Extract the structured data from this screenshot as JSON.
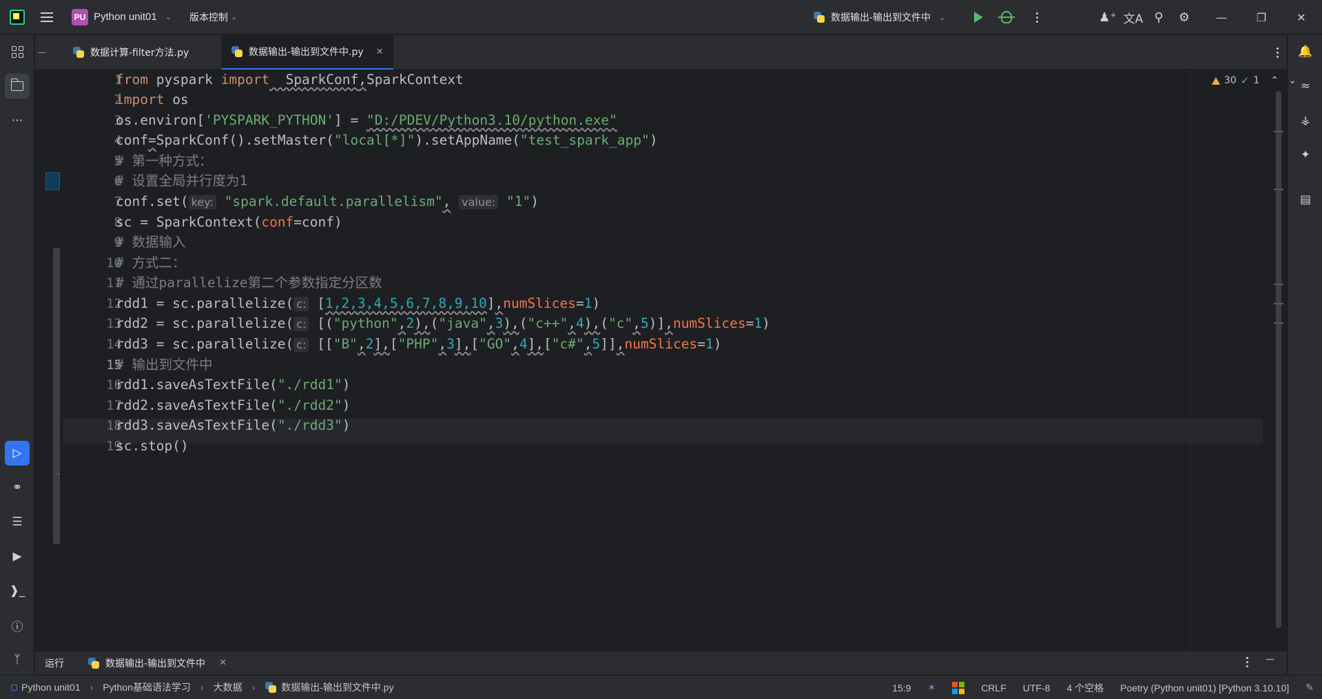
{
  "titlebar": {
    "project_badge": "PU",
    "project_name": "Python unit01",
    "vcs_label": "版本控制",
    "run_config": "数据输出-输出到文件中"
  },
  "tabs": [
    {
      "label": "数据计算-filter方法.py",
      "active": false
    },
    {
      "label": "数据输出-输出到文件中.py",
      "active": true
    }
  ],
  "inspections": {
    "warnings": "30",
    "ok": "1"
  },
  "editor": {
    "current_line": 15,
    "line_numbers": [
      "1",
      "2",
      "3",
      "4",
      "5",
      "6",
      "7",
      "8",
      "9",
      "10",
      "11",
      "12",
      "13",
      "14",
      "15",
      "16",
      "17",
      "18",
      "19"
    ]
  },
  "code": {
    "l1": {
      "kw1": "from",
      "t1": " pyspark ",
      "kw2": "import",
      "t2": "  SparkConf",
      "t3": ",",
      "t4": "SparkContext"
    },
    "l2": {
      "kw": "import",
      "t": " os"
    },
    "l3": {
      "t1": "os.environ[",
      "s1": "'PYSPARK_PYTHON'",
      "t2": "] = ",
      "s2": "\"D:/PDEV/Python3.10/python.exe\""
    },
    "l4": {
      "t1": "conf",
      "t2": "=",
      "t3": "SparkConf().setMaster(",
      "s1": "\"local[*]\"",
      "t4": ").setAppName(",
      "s2": "\"test_spark_app\"",
      "t5": ")"
    },
    "l5": {
      "c": "# 第一种方式："
    },
    "l6": {
      "c": "# 设置全局并行度为1"
    },
    "l7": {
      "t1": "conf.set(",
      "h1": "key:",
      "s1": "\"spark.default.parallelism\"",
      "t2": ",",
      "h2": "value:",
      "s2": "\"1\"",
      "t3": ")"
    },
    "l8": {
      "t1": "sc = SparkContext(",
      "p": "conf",
      "t2": "=conf)"
    },
    "l9": {
      "c": "# 数据输入"
    },
    "l10": {
      "c": "# 方式二："
    },
    "l11": {
      "c": "# 通过parallelize第二个参数指定分区数"
    },
    "l12": {
      "t1": "rdd1 = sc.parallelize(",
      "h": "c:",
      "t2": "[",
      "nums": "1,2,3,4,5,6,7,8,9,10",
      "t3": "]",
      "t4": ",",
      "p": "numSlices",
      "t5": "=",
      "n": "1",
      "t6": ")"
    },
    "l13": {
      "t1": "rdd2 = sc.parallelize(",
      "h": "c:",
      "t2": "[(",
      "s1": "\"python\"",
      "a1": ",",
      "n1": "2",
      "a2": "),",
      "a3": "(",
      "s2": "\"java\"",
      "a4": ",",
      "n2": "3",
      "a5": "),",
      "a6": "(",
      "s3": "\"c++\"",
      "a7": ",",
      "n3": "4",
      "a8": "),",
      "a9": "(",
      "s4": "\"c\"",
      "a10": ",",
      "n4": "5",
      "a11": ")]",
      "a12": ",",
      "p": "numSlices",
      "t3": "=",
      "n": "1",
      "t4": ")"
    },
    "l14": {
      "t1": "rdd3 = sc.parallelize(",
      "h": "c:",
      "t2": "[[",
      "s1": "\"B\"",
      "a1": ",",
      "n1": "2",
      "a2": "],",
      "a3": "[",
      "s2": "\"PHP\"",
      "a4": ",",
      "n2": "3",
      "a5": "],",
      "a6": "[",
      "s3": "\"GO\"",
      "a7": ",",
      "n3": "4",
      "a8": "],",
      "a9": "[",
      "s4": "\"c#\"",
      "a10": ",",
      "n4": "5",
      "a11": "]]",
      "a12": ",",
      "p": "numSlices",
      "t3": "=",
      "n": "1",
      "t4": ")"
    },
    "l15": {
      "c": "# 输出到文件中"
    },
    "l16": {
      "t1": "rdd1.saveAsTextFile(",
      "s": "\"./rdd1\"",
      "t2": ")"
    },
    "l17": {
      "t1": "rdd2.saveAsTextFile(",
      "s": "\"./rdd2\"",
      "t2": ")"
    },
    "l18": {
      "t1": "rdd3.saveAsTextFile(",
      "s": "\"./rdd3\"",
      "t2": ")"
    },
    "l19": {
      "t": "sc.stop()"
    }
  },
  "runbar": {
    "label": "运行",
    "tab": "数据输出-输出到文件中"
  },
  "statusbar": {
    "breadcrumbs": [
      "Python unit01",
      "Python基础语法学习",
      "大数据",
      "数据输出-输出到文件中.py"
    ],
    "position": "15:9",
    "line_sep": "CRLF",
    "encoding": "UTF-8",
    "indent": "4 个空格",
    "interpreter": "Poetry (Python unit01) [Python 3.10.10]"
  },
  "colors": {
    "accent": "#3574f0",
    "run_green": "#5fb865",
    "project_badge": "#b34ead"
  },
  "icons": [
    "ide-logo-icon",
    "hamburger-menu-icon",
    "play-icon",
    "debug-icon",
    "more-icon",
    "add-user-icon",
    "translate-icon",
    "search-icon",
    "settings-icon",
    "notifications-icon"
  ]
}
